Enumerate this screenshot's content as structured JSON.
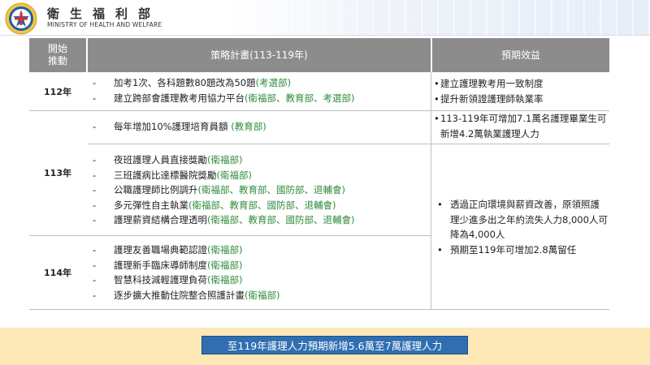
{
  "header": {
    "ministry_cn": "衛生福利部",
    "ministry_en": "MINISTRY OF HEALTH AND WELFARE"
  },
  "table": {
    "headers": [
      "開始\n推動",
      "策略計畫(113-119年)",
      "預期效益"
    ],
    "rows": [
      {
        "year": "112年",
        "plans": [
          {
            "text": "加考1次、各科題數80題改為50題",
            "org": "(考選部)"
          },
          {
            "text": "建立跨部會護理教考用協力平台",
            "org": "(衛福部、教育部、考選部)"
          }
        ],
        "benefits": [
          "建立護理教考用一致制度",
          "提升新領證護理師執業率"
        ]
      },
      {
        "year": "113年",
        "plans_a": [
          {
            "text": "每年增加10%護理培育員額 ",
            "org": "(教育部)"
          }
        ],
        "benefits_a": [
          "113-119年可增加7.1萬名護理畢業生可新增4.2萬執業護理人力"
        ],
        "plans_b": [
          {
            "text": "夜班護理人員直接獎勵",
            "org": "(衛福部)"
          },
          {
            "text": "三班護病比達標醫院獎勵",
            "org": "(衛福部)"
          },
          {
            "text": "公職護理師比例調升",
            "org": "(衛福部、教育部、國防部、退輔會)"
          },
          {
            "text": "多元彈性自主執業",
            "org": "(衛福部、教育部、國防部、退輔會)"
          },
          {
            "text": "護理薪資結構合理透明",
            "org": "(衛福部、教育部、國防部、退輔會)"
          }
        ]
      },
      {
        "year": "114年",
        "plans": [
          {
            "text": "護理友善職場典範認證",
            "org": "(衛福部)"
          },
          {
            "text": "護理新手臨床導師制度",
            "org": "(衛福部)"
          },
          {
            "text": "智慧科技減輕護理負荷",
            "org": "(衛福部)"
          },
          {
            "text": "逐步擴大推動住院整合照護計畫",
            "org": "(衛福部)"
          }
        ],
        "benefits": [
          "透過正向環境與薪資改善，原領照護理少進多出之年約流失人力8,000人可降為4,000人",
          "預期至119年可增加2.8萬留任"
        ]
      }
    ]
  },
  "footer": {
    "summary": "至119年護理人力預期新增5.6萬至7萬護理人力"
  },
  "colors": {
    "header_fill": "#8c8c8c",
    "org_text": "#2e8b3a",
    "footer_band": "#fde9b8",
    "footer_box": "#2f6fb1"
  }
}
